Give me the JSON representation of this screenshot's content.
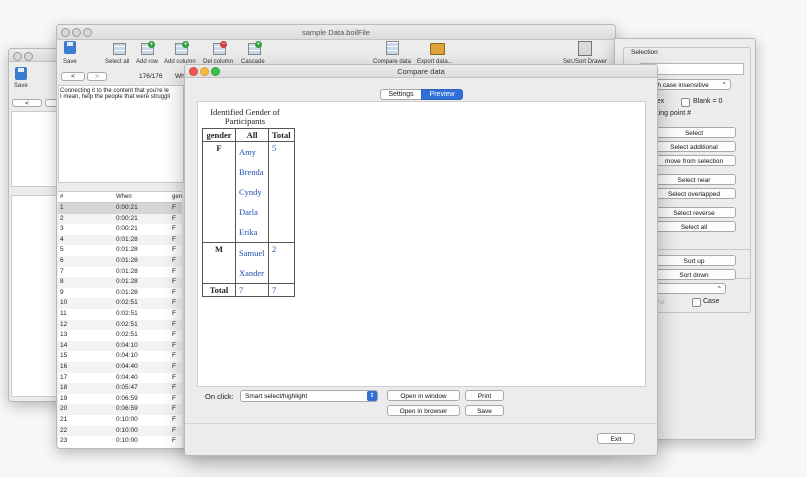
{
  "back_window": {
    "save_label": "Save"
  },
  "main_window": {
    "title": "sample Data.boilFile",
    "toolbar": [
      {
        "label": "Save"
      },
      {
        "label": "Select all"
      },
      {
        "label": "Add row"
      },
      {
        "label": "Add column"
      },
      {
        "label": "Del column"
      },
      {
        "label": "Cascade"
      },
      {
        "label": "Compare data"
      },
      {
        "label": "Export data..."
      },
      {
        "label": "Sel./Sort Drawer"
      }
    ],
    "record_counter": "176/176",
    "record_field_label": "Wh",
    "text_lines": [
      "Connecting it  to the content that you're le",
      "I mean, help the people that were struggli"
    ],
    "columns": [
      "#",
      "When",
      "gen"
    ],
    "rows": [
      {
        "n": "1",
        "when": "0:00:21",
        "g": "F"
      },
      {
        "n": "2",
        "when": "0:00:21",
        "g": "F"
      },
      {
        "n": "3",
        "when": "0:00:21",
        "g": "F"
      },
      {
        "n": "4",
        "when": "0:01:28",
        "g": "F"
      },
      {
        "n": "5",
        "when": "0:01:28",
        "g": "F"
      },
      {
        "n": "6",
        "when": "0:01:28",
        "g": "F"
      },
      {
        "n": "7",
        "when": "0:01:28",
        "g": "F"
      },
      {
        "n": "8",
        "when": "0:01:28",
        "g": "F"
      },
      {
        "n": "9",
        "when": "0:01:28",
        "g": "F"
      },
      {
        "n": "10",
        "when": "0:02:51",
        "g": "F"
      },
      {
        "n": "11",
        "when": "0:02:51",
        "g": "F"
      },
      {
        "n": "12",
        "when": "0:02:51",
        "g": "F"
      },
      {
        "n": "13",
        "when": "0:02:51",
        "g": "F"
      },
      {
        "n": "14",
        "when": "0:04:10",
        "g": "F"
      },
      {
        "n": "15",
        "when": "0:04:10",
        "g": "F"
      },
      {
        "n": "16",
        "when": "0:04:40",
        "g": "F"
      },
      {
        "n": "17",
        "when": "0:04:40",
        "g": "F"
      },
      {
        "n": "18",
        "when": "0:05:47",
        "g": "F"
      },
      {
        "n": "19",
        "when": "0:06:59",
        "g": "F"
      },
      {
        "n": "20",
        "when": "0:06:59",
        "g": "F"
      },
      {
        "n": "21",
        "when": "0:10:00",
        "g": "F"
      },
      {
        "n": "22",
        "when": "0:10:00",
        "g": "F"
      },
      {
        "n": "23",
        "when": "0:10:00",
        "g": "F"
      }
    ]
  },
  "drawer": {
    "selection_label": "Selection",
    "case_mode_value": "rch case insensitive",
    "regex_label": "egex",
    "blank_label": "Blank = 0",
    "floating_label": "oating point #",
    "buttons": [
      "Select",
      "Select additional",
      "move from selection",
      "Select near",
      "Select overlapped",
      "Select reverse",
      "Select all"
    ],
    "sort_up_label": "Sort up",
    "sort_down_label": "Sort down",
    "sort_field_value": "",
    "faded_label": "Pat",
    "case_label": "Case"
  },
  "compare_dialog": {
    "title": "Compare data",
    "tabs": [
      {
        "label": "Settings"
      },
      {
        "label": "Preview"
      }
    ],
    "table": {
      "caption": "Identified Gender of Participants",
      "headers": [
        "gender",
        "All",
        "Total"
      ],
      "groups": [
        {
          "label": "F",
          "names": [
            "Amy",
            "Brenda",
            "Cyndy",
            "Darla",
            "Erika"
          ],
          "count": "5"
        },
        {
          "label": "M",
          "names": [
            "Samuel",
            "Xander"
          ],
          "count": "2"
        }
      ],
      "total_label": "Total",
      "total_all": "7",
      "total_total": "7"
    },
    "on_click_label": "On click:",
    "on_click_value": "Smart select/highlight",
    "open_in_window_label": "Open in window",
    "print_label": "Print",
    "open_in_browser_label": "Open in browser",
    "save_label": "Save",
    "exit_label": "Exit"
  }
}
